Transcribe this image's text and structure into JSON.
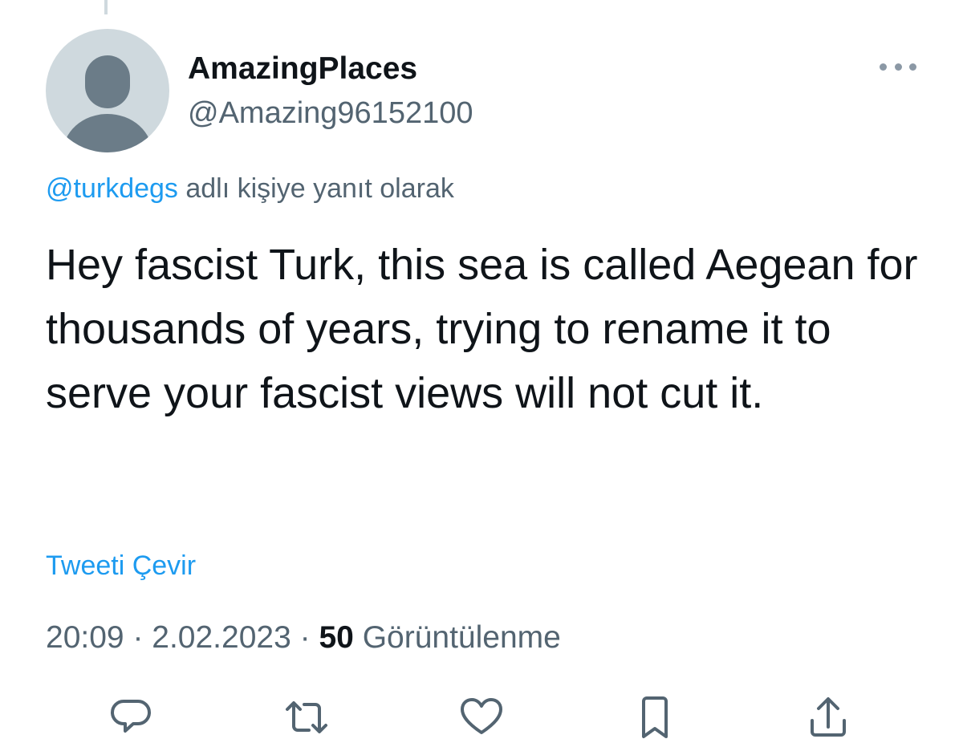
{
  "author": {
    "display_name": "AmazingPlaces",
    "handle": "@Amazing96152100"
  },
  "reply_context": {
    "mention": "@turkdegs",
    "suffix": " adlı kişiye yanıt olarak"
  },
  "tweet": {
    "text": "Hey fascist Turk, this sea is called Aegean for thousands of years, trying to rename it to serve your fascist views will not cut it.",
    "translate_label": "Tweeti Çevir",
    "time": "20:09",
    "separator": " · ",
    "date": "2.02.2023",
    "views_count": "50",
    "views_label": " Görüntülenme"
  },
  "actions": [
    {
      "icon": "reply-icon"
    },
    {
      "icon": "retweet-icon"
    },
    {
      "icon": "like-icon"
    },
    {
      "icon": "bookmark-icon"
    },
    {
      "icon": "share-icon"
    }
  ],
  "colors": {
    "link": "#1d9bf0",
    "secondary_text": "#536471",
    "primary_text": "#0f1419",
    "avatar_bg": "#cfd9de",
    "avatar_fg": "#6b7c88"
  }
}
